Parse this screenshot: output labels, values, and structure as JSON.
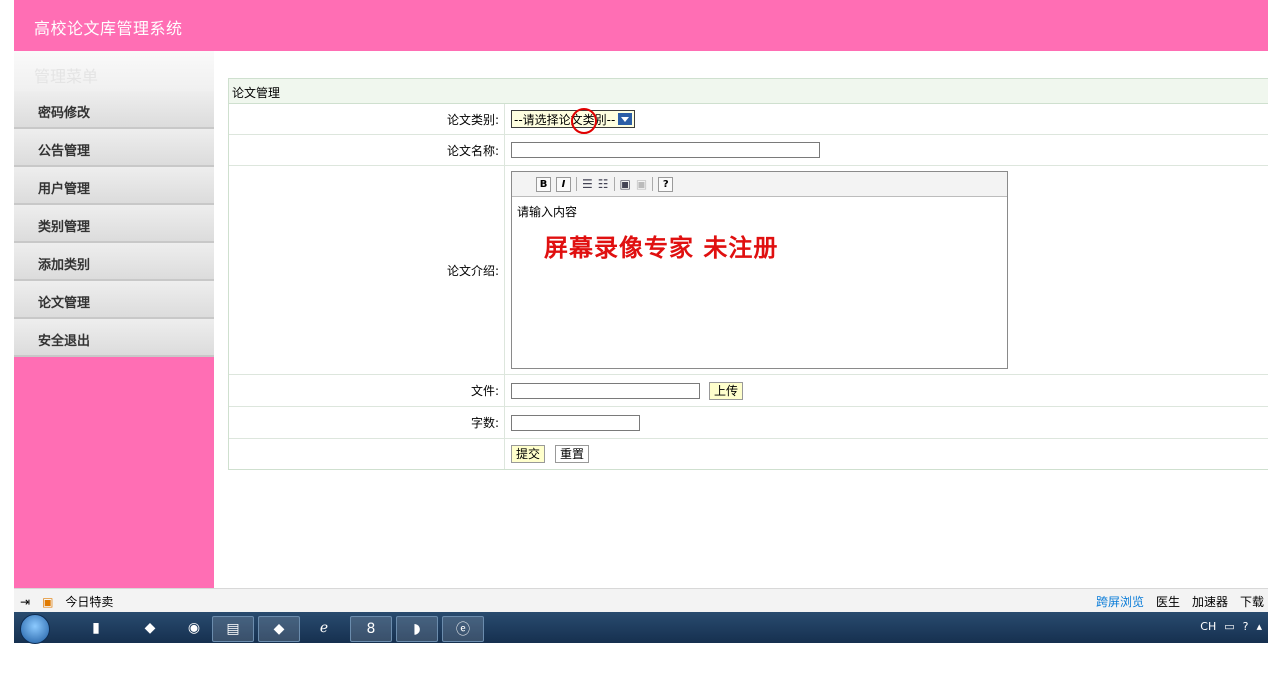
{
  "app": {
    "title": "高校论文库管理系统"
  },
  "sidebar": {
    "heading": "管理菜单",
    "items": [
      {
        "label": "密码修改"
      },
      {
        "label": "公告管理"
      },
      {
        "label": "用户管理"
      },
      {
        "label": "类别管理"
      },
      {
        "label": "添加类别"
      },
      {
        "label": "论文管理"
      },
      {
        "label": "安全退出"
      }
    ]
  },
  "panel": {
    "title": "论文管理"
  },
  "form": {
    "category_label": "论文类别:",
    "category_value": "--请选择论文类别--",
    "name_label": "论文名称:",
    "name_value": "",
    "intro_label": "论文介绍:",
    "intro_value": "请输入内容",
    "file_label": "文件:",
    "upload_label": "上传",
    "words_label": "字数:",
    "submit_label": "提交",
    "reset_label": "重置"
  },
  "editor": {
    "toolbar": [
      "bold-icon",
      "italic-icon",
      "ordered-list-icon",
      "unordered-list-icon",
      "image-icon",
      "image-disabled-icon",
      "help-icon"
    ],
    "bold": "B",
    "italic": "I",
    "help": "?"
  },
  "watermark": "屏幕录像专家  未注册",
  "statusbar": {
    "deal": "今日特卖",
    "items": [
      "跨屏浏览",
      "医生",
      "加速器",
      "下载"
    ]
  },
  "taskbar": {
    "tray_lang": "CH"
  }
}
